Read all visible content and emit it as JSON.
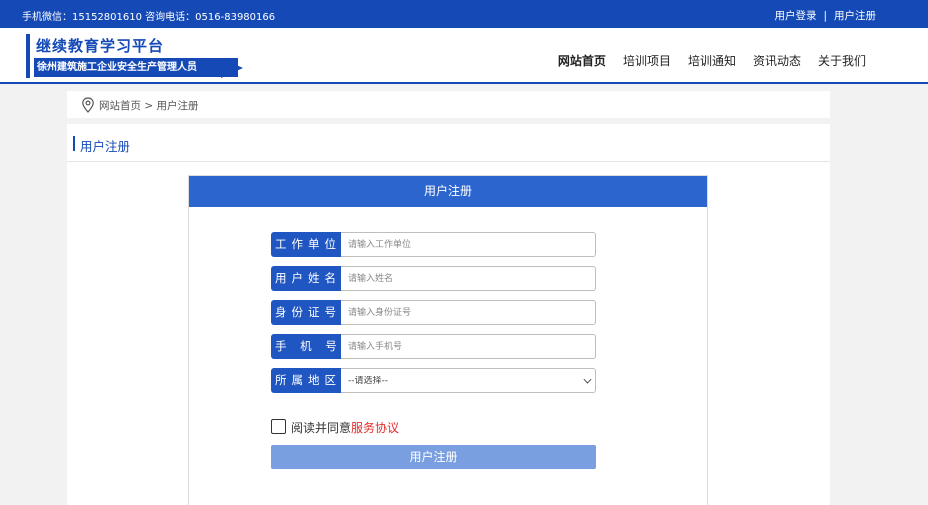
{
  "topbar": {
    "contact": "手机微信：15152801610 咨询电话：0516-83980166",
    "login": "用户登录",
    "separator": "|",
    "register": "用户注册"
  },
  "brand": {
    "title": "继续教育学习平台",
    "subtitle": "徐州建筑施工企业安全生产管理人员"
  },
  "nav": {
    "items": [
      {
        "label": "网站首页",
        "active": true
      },
      {
        "label": "培训项目"
      },
      {
        "label": "培训通知"
      },
      {
        "label": "资讯动态"
      },
      {
        "label": "关于我们"
      }
    ]
  },
  "breadcrumb": {
    "icon": "location-pin-icon",
    "text": "网站首页 > 用户注册"
  },
  "panel": {
    "title": "用户注册"
  },
  "form": {
    "header": "用户注册",
    "fields": [
      {
        "label": "工作单位",
        "placeholder": "请输入工作单位",
        "value": ""
      },
      {
        "label": "用户姓名",
        "placeholder": "请输入姓名",
        "value": ""
      },
      {
        "label": "身份证号",
        "placeholder": "请输入身份证号",
        "value": ""
      },
      {
        "label": "手 机 号",
        "placeholder": "请输入手机号",
        "value": ""
      },
      {
        "label": "所属地区",
        "selected": "--请选择--"
      }
    ],
    "agree_prefix": "阅读并同意",
    "agree_link": "服务协议",
    "submit": "用户注册"
  },
  "colors": {
    "brand_blue": "#1449b6",
    "form_header": "#2d65cf",
    "submit_button": "#7a9fe0",
    "link_red": "#e12b2b"
  }
}
